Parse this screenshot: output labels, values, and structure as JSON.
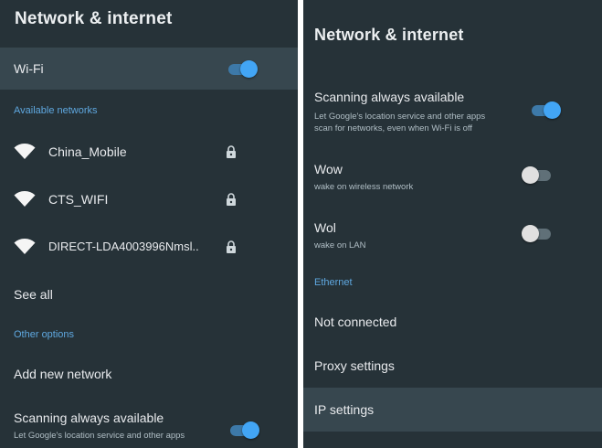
{
  "colors": {
    "background": "#263238",
    "highlight": "#37474f",
    "accent": "#42a5f5",
    "section_header": "#5fa8e0",
    "text": "#e8eaed"
  },
  "left": {
    "title": "Network & internet",
    "wifi": {
      "label": "Wi-Fi",
      "toggle_on": true
    },
    "available_header": "Available networks",
    "networks": [
      {
        "ssid": "China_Mobile",
        "icon": "wifi-icon",
        "secured": true
      },
      {
        "ssid": "CTS_WIFI",
        "icon": "wifi-icon",
        "secured": true
      },
      {
        "ssid": "DIRECT-LDA4003996Nmsl..",
        "icon": "wifi-icon",
        "secured": true
      }
    ],
    "see_all": "See all",
    "other_header": "Other options",
    "add_network": "Add new network",
    "scanning": {
      "label": "Scanning always available",
      "sub": "Let Google's location service and other apps",
      "toggle_on": true
    }
  },
  "right": {
    "title": "Network & internet",
    "scanning": {
      "label": "Scanning always available",
      "sub1": "Let Google's location service and other apps",
      "sub2": "scan for networks, even when Wi-Fi is off",
      "toggle_on": true
    },
    "wow": {
      "label": "Wow",
      "sub": "wake on wireless network",
      "toggle_on": false
    },
    "wol": {
      "label": "Wol",
      "sub": "wake on LAN",
      "toggle_on": false
    },
    "ethernet_header": "Ethernet",
    "not_connected": "Not connected",
    "proxy": "Proxy settings",
    "ip": "IP settings"
  }
}
